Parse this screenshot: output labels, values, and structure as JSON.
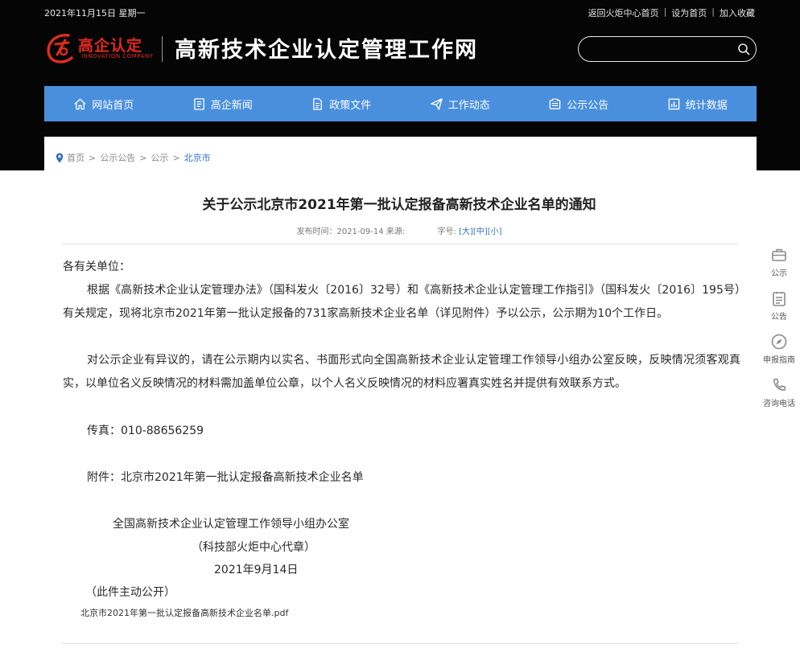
{
  "header": {
    "date": "2021年11月15日 星期一",
    "top_links": [
      "返回火炬中心首页",
      "设为首页",
      "加入收藏"
    ],
    "logo_cn": "高企认定",
    "logo_en": "INNOVATION COMPANY",
    "site_title": "高新技术企业认定管理工作网",
    "search_placeholder": ""
  },
  "nav": [
    {
      "label": "网站首页",
      "icon": "home-icon"
    },
    {
      "label": "高企新闻",
      "icon": "news-icon"
    },
    {
      "label": "政策文件",
      "icon": "document-icon"
    },
    {
      "label": "工作动态",
      "icon": "send-icon"
    },
    {
      "label": "公示公告",
      "icon": "notice-icon"
    },
    {
      "label": "统计数据",
      "icon": "stats-icon"
    }
  ],
  "breadcrumb": [
    "首页",
    "公示公告",
    "公示",
    "北京市"
  ],
  "article": {
    "title": "关于公示北京市2021年第一批认定报备高新技术企业名单的通知",
    "meta_date": "发布时间：2021-09-14 来源:",
    "meta_font": "字号:",
    "size_large": "[大]",
    "size_medium": "[中]",
    "size_small": "[小]",
    "salutation": "各有关单位：",
    "para1": "根据《高新技术企业认定管理办法》（国科发火〔2016〕32号）和《高新技术企业认定管理工作指引》（国科发火〔2016〕195号）有关规定，现将北京市2021年第一批认定报备的731家高新技术企业名单（详见附件）予以公示，公示期为10个工作日。",
    "para2": "对公示企业有异议的，请在公示期内以实名、书面形式向全国高新技术企业认定管理工作领导小组办公室反映，反映情况须客观真实，以单位名义反映情况的材料需加盖单位公章，以个人名义反映情况的材料应署真实姓名并提供有效联系方式。",
    "fax": "传真：010-88656259",
    "attachment": "附件：北京市2021年第一批认定报备高新技术企业名单",
    "sign_org": "全国高新技术企业认定管理工作领导小组办公室",
    "sign_sub": "（科技部火炬中心代章）",
    "sign_date": "2021年9月14日",
    "public_note": "（此件主动公开）",
    "pdf_name": "北京市2021年第一批认定报备高新技术企业名单.pdf"
  },
  "float_bar": [
    {
      "label": "公示",
      "icon": "briefcase-icon"
    },
    {
      "label": "公告",
      "icon": "clipboard-icon"
    },
    {
      "label": "申报指南",
      "icon": "compass-icon"
    },
    {
      "label": "咨询电话",
      "icon": "phone-icon"
    }
  ],
  "colors": {
    "nav_bg": "#4a8fdd",
    "logo_red": "#e02a20",
    "link_blue": "#2f6fc4",
    "top_bg": "#050505"
  }
}
